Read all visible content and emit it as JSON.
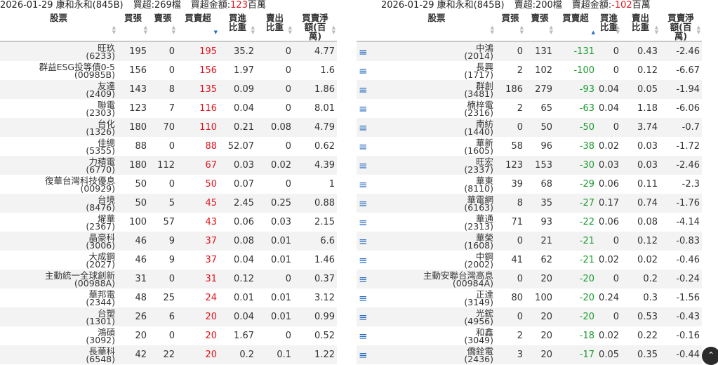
{
  "left": {
    "summary": {
      "date_name": "2026-01-29 康和永和(845B)",
      "count": "買超:269檔",
      "amount_label": "買超金額:",
      "amount_value": "123",
      "amount_unit": "百萬"
    },
    "headers": [
      "股票",
      "買張",
      "賣張",
      "買賣超",
      "買進比重",
      "賣出比重",
      "買賣淨額(百萬)"
    ],
    "rows": [
      {
        "name": "旺玖",
        "code": "(6233)",
        "buy": "195",
        "sell": "0",
        "net": "195",
        "bw": "35.2",
        "sw": "0",
        "amt": "4.77"
      },
      {
        "name": "群益ESG投等債0-5",
        "code": "(00985B)",
        "buy": "156",
        "sell": "0",
        "net": "156",
        "bw": "1.97",
        "sw": "0",
        "amt": "1.6"
      },
      {
        "name": "友達",
        "code": "(2409)",
        "buy": "143",
        "sell": "8",
        "net": "135",
        "bw": "0.09",
        "sw": "0",
        "amt": "1.86"
      },
      {
        "name": "聯電",
        "code": "(2303)",
        "buy": "123",
        "sell": "7",
        "net": "116",
        "bw": "0.04",
        "sw": "0",
        "amt": "8.01"
      },
      {
        "name": "台化",
        "code": "(1326)",
        "buy": "180",
        "sell": "70",
        "net": "110",
        "bw": "0.21",
        "sw": "0.08",
        "amt": "4.79"
      },
      {
        "name": "佳總",
        "code": "(5355)",
        "buy": "88",
        "sell": "0",
        "net": "88",
        "bw": "52.07",
        "sw": "0",
        "amt": "0.62"
      },
      {
        "name": "力積電",
        "code": "(6770)",
        "buy": "180",
        "sell": "112",
        "net": "67",
        "bw": "0.03",
        "sw": "0.02",
        "amt": "4.39"
      },
      {
        "name": "復華台灣科技優息",
        "code": "(00929)",
        "buy": "50",
        "sell": "0",
        "net": "50",
        "bw": "0.07",
        "sw": "0",
        "amt": "1"
      },
      {
        "name": "台境",
        "code": "(8476)",
        "buy": "50",
        "sell": "5",
        "net": "45",
        "bw": "2.45",
        "sw": "0.25",
        "amt": "0.88"
      },
      {
        "name": "燿華",
        "code": "(2367)",
        "buy": "100",
        "sell": "57",
        "net": "43",
        "bw": "0.06",
        "sw": "0.03",
        "amt": "2.15"
      },
      {
        "name": "晶豪科",
        "code": "(3006)",
        "buy": "46",
        "sell": "9",
        "net": "37",
        "bw": "0.08",
        "sw": "0.01",
        "amt": "6.6"
      },
      {
        "name": "大成鋼",
        "code": "(2027)",
        "buy": "46",
        "sell": "9",
        "net": "37",
        "bw": "0.04",
        "sw": "0.01",
        "amt": "1.46"
      },
      {
        "name": "主動統一全球創新",
        "code": "(00988A)",
        "buy": "31",
        "sell": "0",
        "net": "31",
        "bw": "0.12",
        "sw": "0",
        "amt": "0.37"
      },
      {
        "name": "華邦電",
        "code": "(2344)",
        "buy": "48",
        "sell": "25",
        "net": "24",
        "bw": "0.01",
        "sw": "0.01",
        "amt": "3.12"
      },
      {
        "name": "台塑",
        "code": "(1301)",
        "buy": "26",
        "sell": "6",
        "net": "20",
        "bw": "0.04",
        "sw": "0.01",
        "amt": "0.99"
      },
      {
        "name": "鴻碩",
        "code": "(3092)",
        "buy": "20",
        "sell": "0",
        "net": "20",
        "bw": "1.67",
        "sw": "0",
        "amt": "0.52"
      },
      {
        "name": "長華科",
        "code": "(6548)",
        "buy": "42",
        "sell": "22",
        "net": "20",
        "bw": "0.2",
        "sw": "0.1",
        "amt": "1.22"
      }
    ]
  },
  "right": {
    "summary": {
      "date_name": "2026-01-29 康和永和(845B)",
      "count": "賣超:200檔",
      "amount_label": "賣超金額:",
      "amount_value": "-102",
      "amount_unit": "百萬"
    },
    "headers": [
      "股票",
      "買張",
      "賣張",
      "買賣超",
      "買進比重",
      "賣出比重",
      "買賣淨額(百萬)"
    ],
    "rows": [
      {
        "name": "中鴻",
        "code": "(2014)",
        "buy": "0",
        "sell": "131",
        "net": "-131",
        "bw": "0",
        "sw": "0.43",
        "amt": "-2.46"
      },
      {
        "name": "長興",
        "code": "(1717)",
        "buy": "2",
        "sell": "102",
        "net": "-100",
        "bw": "0",
        "sw": "0.12",
        "amt": "-6.67"
      },
      {
        "name": "群創",
        "code": "(3481)",
        "buy": "186",
        "sell": "279",
        "net": "-93",
        "bw": "0.04",
        "sw": "0.05",
        "amt": "-1.94"
      },
      {
        "name": "楠梓電",
        "code": "(2316)",
        "buy": "2",
        "sell": "65",
        "net": "-63",
        "bw": "0.04",
        "sw": "1.18",
        "amt": "-6.06"
      },
      {
        "name": "南紡",
        "code": "(1440)",
        "buy": "0",
        "sell": "50",
        "net": "-50",
        "bw": "0",
        "sw": "3.74",
        "amt": "-0.7"
      },
      {
        "name": "華新",
        "code": "(1605)",
        "buy": "58",
        "sell": "96",
        "net": "-38",
        "bw": "0.02",
        "sw": "0.03",
        "amt": "-1.72"
      },
      {
        "name": "旺宏",
        "code": "(2337)",
        "buy": "123",
        "sell": "153",
        "net": "-30",
        "bw": "0.03",
        "sw": "0.03",
        "amt": "-2.46"
      },
      {
        "name": "華東",
        "code": "(8110)",
        "buy": "39",
        "sell": "68",
        "net": "-29",
        "bw": "0.06",
        "sw": "0.11",
        "amt": "-2.3"
      },
      {
        "name": "華電網",
        "code": "(6163)",
        "buy": "8",
        "sell": "35",
        "net": "-27",
        "bw": "0.17",
        "sw": "0.74",
        "amt": "-1.76"
      },
      {
        "name": "華通",
        "code": "(2313)",
        "buy": "71",
        "sell": "93",
        "net": "-22",
        "bw": "0.06",
        "sw": "0.08",
        "amt": "-4.14"
      },
      {
        "name": "華榮",
        "code": "(1608)",
        "buy": "0",
        "sell": "21",
        "net": "-21",
        "bw": "0",
        "sw": "0.12",
        "amt": "-0.83"
      },
      {
        "name": "中鋼",
        "code": "(2002)",
        "buy": "41",
        "sell": "62",
        "net": "-21",
        "bw": "0.02",
        "sw": "0.02",
        "amt": "-0.46"
      },
      {
        "name": "主動安聯台灣高息",
        "code": "(00984A)",
        "buy": "0",
        "sell": "20",
        "net": "-20",
        "bw": "0",
        "sw": "0.2",
        "amt": "-0.24"
      },
      {
        "name": "正達",
        "code": "(3149)",
        "buy": "80",
        "sell": "100",
        "net": "-20",
        "bw": "0.24",
        "sw": "0.3",
        "amt": "-1.56"
      },
      {
        "name": "光鋐",
        "code": "(4956)",
        "buy": "0",
        "sell": "20",
        "net": "-20",
        "bw": "0",
        "sw": "0.53",
        "amt": "-0.43"
      },
      {
        "name": "和鑫",
        "code": "(3049)",
        "buy": "2",
        "sell": "20",
        "net": "-18",
        "bw": "0.02",
        "sw": "0.22",
        "amt": "-0.16"
      },
      {
        "name": "僑銓電",
        "code": "(2436)",
        "buy": "3",
        "sell": "20",
        "net": "-17",
        "bw": "0.05",
        "sw": "0.35",
        "amt": "-0.44"
      }
    ]
  },
  "icons": {
    "row_menu": "menu-icon",
    "scroll_top": "chevron-up-icon"
  },
  "colors": {
    "positive": "#e0141e",
    "negative": "#1a9a2f",
    "accent": "#2a6ebf"
  }
}
